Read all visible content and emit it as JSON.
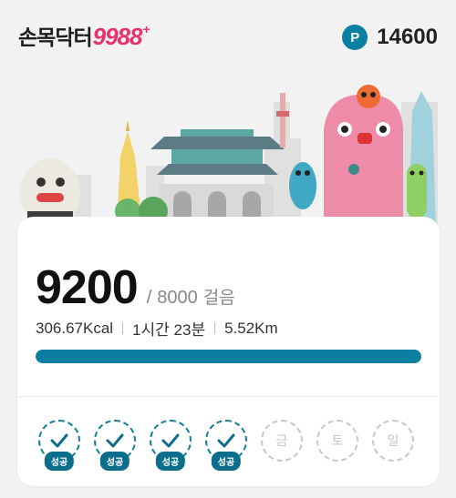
{
  "header": {
    "logo_korean": "손목닥터",
    "logo_number": "9988",
    "logo_plus": "+",
    "points_icon_letter": "P",
    "points_value": "14600"
  },
  "steps": {
    "count": "9200",
    "separator": "/",
    "goal": "8000",
    "unit": "걸음",
    "progress_ratio": 1.0
  },
  "stats": {
    "calories": "306.67Kcal",
    "duration": "1시간 23분",
    "distance": "5.52Km"
  },
  "week": [
    {
      "label": "성공",
      "status": "done"
    },
    {
      "label": "성공",
      "status": "done"
    },
    {
      "label": "성공",
      "status": "done"
    },
    {
      "label": "성공",
      "status": "done"
    },
    {
      "label": "금",
      "status": "pending"
    },
    {
      "label": "토",
      "status": "pending"
    },
    {
      "label": "일",
      "status": "pending"
    }
  ],
  "colors": {
    "brand_teal": "#0a7fa2",
    "logo_pink": "#e8326e",
    "background": "#f2f2f2"
  }
}
